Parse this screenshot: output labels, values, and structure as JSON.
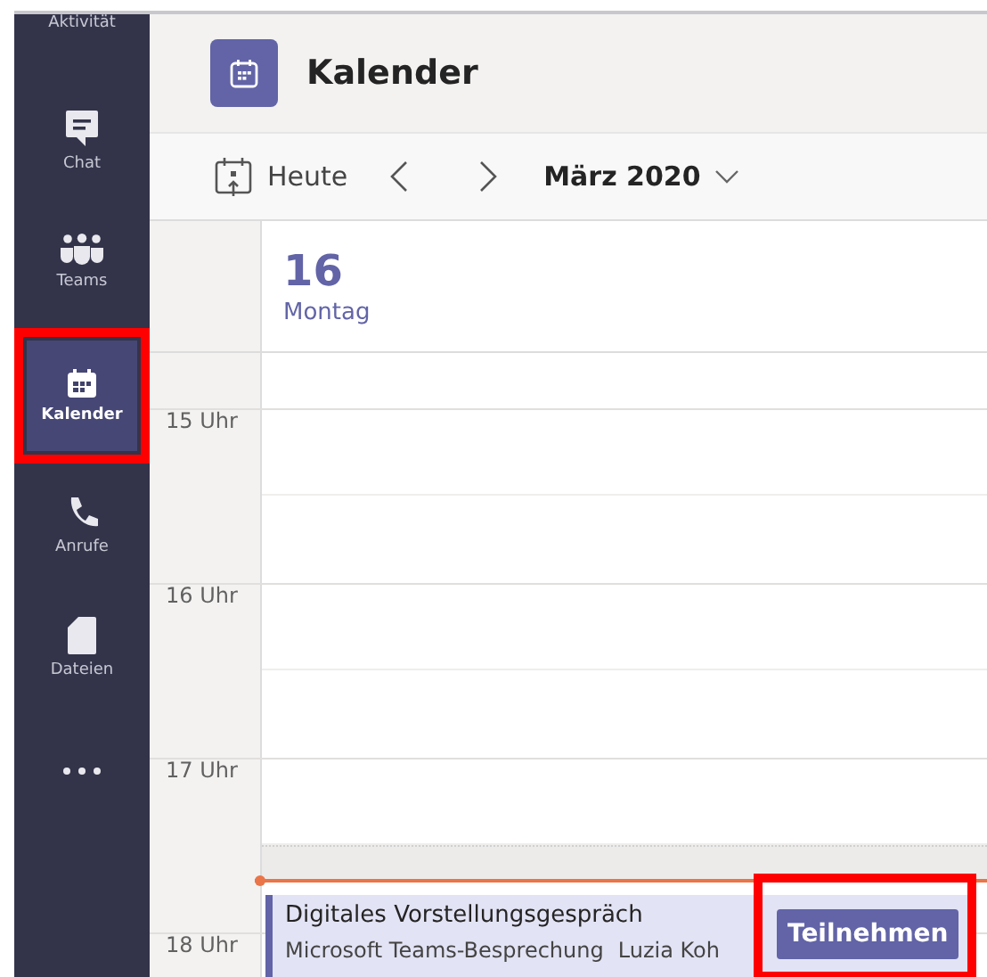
{
  "sidebar": {
    "items": [
      {
        "label": "Aktivität",
        "selected": false,
        "highlighted": false
      },
      {
        "label": "Chat",
        "selected": false,
        "highlighted": false
      },
      {
        "label": "Teams",
        "selected": false,
        "highlighted": false
      },
      {
        "label": "Kalender",
        "selected": true,
        "highlighted": true
      },
      {
        "label": "Anrufe",
        "selected": false,
        "highlighted": false
      },
      {
        "label": "Dateien",
        "selected": false,
        "highlighted": false
      }
    ]
  },
  "header": {
    "title": "Kalender"
  },
  "toolbar": {
    "today": "Heute",
    "month": "März 2020"
  },
  "day": {
    "number": "16",
    "weekday": "Montag"
  },
  "hours": [
    "15 Uhr",
    "16 Uhr",
    "17 Uhr",
    "18 Uhr"
  ],
  "event": {
    "title": "Digitales Vorstellungsgespräch",
    "type": "Microsoft Teams-Besprechung",
    "organizer": "Luzia Koh",
    "join_label": "Teilnehmen",
    "join_highlighted": true
  }
}
